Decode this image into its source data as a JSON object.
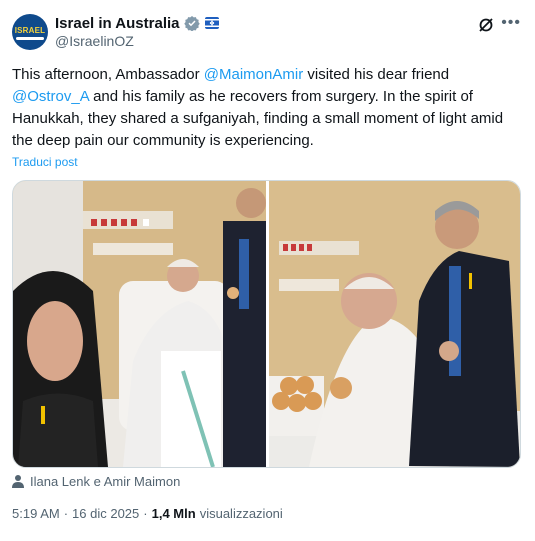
{
  "account": {
    "name": "Israel in Australia",
    "handle": "@IsraelinOZ",
    "avatar_text": "ISRAEL"
  },
  "post": {
    "text_1": "This afternoon, Ambassador ",
    "mention_1": "@MaimonAmir",
    "text_2": " visited his dear friend\n",
    "mention_2": "@Ostrov_A",
    "text_3": " and his family as he recovers from surgery. In the spirit of Hanukkah, they shared a sufganiyah, finding a small moment of light amid the deep pain our community is experiencing.",
    "translate_label": "Traduci post"
  },
  "media": {
    "tagged": "Ilana Lenk e Amir Maimon"
  },
  "meta": {
    "time": "5:19 AM",
    "separator": "·",
    "date": "16 dic 2025",
    "views_count": "1,4 Mln",
    "views_label": "visualizzazioni"
  },
  "icons": {
    "verified": "verified-badge-icon",
    "affiliation": "flag-icon",
    "grok": "grok-icon",
    "more": "more-icon",
    "person": "person-icon"
  },
  "colors": {
    "link": "#1d9bf0",
    "secondary_text": "#536471",
    "text": "#0f1419"
  }
}
